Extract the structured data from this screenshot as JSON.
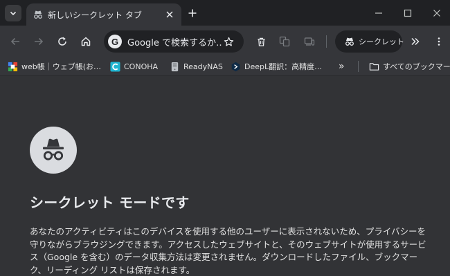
{
  "tab": {
    "title": "新しいシークレット タブ"
  },
  "omnibox": {
    "text": "Google で検索するか…",
    "engine_badge": "G"
  },
  "profile_chip": {
    "label": "シークレット"
  },
  "bookmarks": [
    {
      "label": "web帳｜ウェブ帳(お…",
      "icon": "colorful-blocks-icon"
    },
    {
      "label": "CONOHA",
      "icon": "conoha-icon"
    },
    {
      "label": "ReadyNAS",
      "icon": "nas-device-icon"
    },
    {
      "label": "DeepL翻訳：高精度…",
      "icon": "deepl-icon"
    }
  ],
  "bookmarks_overflow": "»",
  "all_bookmarks": {
    "label": "すべてのブックマーク"
  },
  "page": {
    "heading": "シークレット モードです",
    "description": "あなたのアクティビティはこのデバイスを使用する他のユーザーに表示されないため、プライバシーを守りながらブラウジングできます。アクセスしたウェブサイトと、そのウェブサイトが使用するサービス（Google を含む）のデータ収集方法は変更されません。ダウンロードしたファイル、ブックマーク、リーディング リストは保存されます。"
  },
  "colors": {
    "frame": "#202124",
    "toolbar": "#35363a",
    "page_bg": "#323336",
    "text": "#e8eaed",
    "logo_bg": "#dadce0"
  }
}
